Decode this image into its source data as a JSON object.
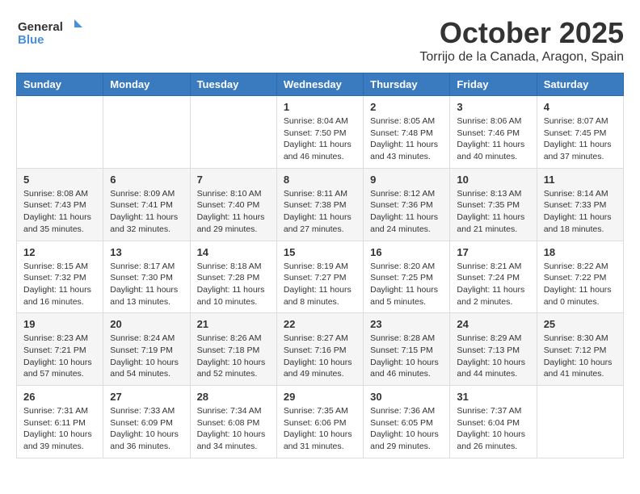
{
  "header": {
    "logo_general": "General",
    "logo_blue": "Blue",
    "month_title": "October 2025",
    "location": "Torrijo de la Canada, Aragon, Spain"
  },
  "days_of_week": [
    "Sunday",
    "Monday",
    "Tuesday",
    "Wednesday",
    "Thursday",
    "Friday",
    "Saturday"
  ],
  "weeks": [
    [
      {
        "day": "",
        "info": ""
      },
      {
        "day": "",
        "info": ""
      },
      {
        "day": "",
        "info": ""
      },
      {
        "day": "1",
        "info": "Sunrise: 8:04 AM\nSunset: 7:50 PM\nDaylight: 11 hours\nand 46 minutes."
      },
      {
        "day": "2",
        "info": "Sunrise: 8:05 AM\nSunset: 7:48 PM\nDaylight: 11 hours\nand 43 minutes."
      },
      {
        "day": "3",
        "info": "Sunrise: 8:06 AM\nSunset: 7:46 PM\nDaylight: 11 hours\nand 40 minutes."
      },
      {
        "day": "4",
        "info": "Sunrise: 8:07 AM\nSunset: 7:45 PM\nDaylight: 11 hours\nand 37 minutes."
      }
    ],
    [
      {
        "day": "5",
        "info": "Sunrise: 8:08 AM\nSunset: 7:43 PM\nDaylight: 11 hours\nand 35 minutes."
      },
      {
        "day": "6",
        "info": "Sunrise: 8:09 AM\nSunset: 7:41 PM\nDaylight: 11 hours\nand 32 minutes."
      },
      {
        "day": "7",
        "info": "Sunrise: 8:10 AM\nSunset: 7:40 PM\nDaylight: 11 hours\nand 29 minutes."
      },
      {
        "day": "8",
        "info": "Sunrise: 8:11 AM\nSunset: 7:38 PM\nDaylight: 11 hours\nand 27 minutes."
      },
      {
        "day": "9",
        "info": "Sunrise: 8:12 AM\nSunset: 7:36 PM\nDaylight: 11 hours\nand 24 minutes."
      },
      {
        "day": "10",
        "info": "Sunrise: 8:13 AM\nSunset: 7:35 PM\nDaylight: 11 hours\nand 21 minutes."
      },
      {
        "day": "11",
        "info": "Sunrise: 8:14 AM\nSunset: 7:33 PM\nDaylight: 11 hours\nand 18 minutes."
      }
    ],
    [
      {
        "day": "12",
        "info": "Sunrise: 8:15 AM\nSunset: 7:32 PM\nDaylight: 11 hours\nand 16 minutes."
      },
      {
        "day": "13",
        "info": "Sunrise: 8:17 AM\nSunset: 7:30 PM\nDaylight: 11 hours\nand 13 minutes."
      },
      {
        "day": "14",
        "info": "Sunrise: 8:18 AM\nSunset: 7:28 PM\nDaylight: 11 hours\nand 10 minutes."
      },
      {
        "day": "15",
        "info": "Sunrise: 8:19 AM\nSunset: 7:27 PM\nDaylight: 11 hours\nand 8 minutes."
      },
      {
        "day": "16",
        "info": "Sunrise: 8:20 AM\nSunset: 7:25 PM\nDaylight: 11 hours\nand 5 minutes."
      },
      {
        "day": "17",
        "info": "Sunrise: 8:21 AM\nSunset: 7:24 PM\nDaylight: 11 hours\nand 2 minutes."
      },
      {
        "day": "18",
        "info": "Sunrise: 8:22 AM\nSunset: 7:22 PM\nDaylight: 11 hours\nand 0 minutes."
      }
    ],
    [
      {
        "day": "19",
        "info": "Sunrise: 8:23 AM\nSunset: 7:21 PM\nDaylight: 10 hours\nand 57 minutes."
      },
      {
        "day": "20",
        "info": "Sunrise: 8:24 AM\nSunset: 7:19 PM\nDaylight: 10 hours\nand 54 minutes."
      },
      {
        "day": "21",
        "info": "Sunrise: 8:26 AM\nSunset: 7:18 PM\nDaylight: 10 hours\nand 52 minutes."
      },
      {
        "day": "22",
        "info": "Sunrise: 8:27 AM\nSunset: 7:16 PM\nDaylight: 10 hours\nand 49 minutes."
      },
      {
        "day": "23",
        "info": "Sunrise: 8:28 AM\nSunset: 7:15 PM\nDaylight: 10 hours\nand 46 minutes."
      },
      {
        "day": "24",
        "info": "Sunrise: 8:29 AM\nSunset: 7:13 PM\nDaylight: 10 hours\nand 44 minutes."
      },
      {
        "day": "25",
        "info": "Sunrise: 8:30 AM\nSunset: 7:12 PM\nDaylight: 10 hours\nand 41 minutes."
      }
    ],
    [
      {
        "day": "26",
        "info": "Sunrise: 7:31 AM\nSunset: 6:11 PM\nDaylight: 10 hours\nand 39 minutes."
      },
      {
        "day": "27",
        "info": "Sunrise: 7:33 AM\nSunset: 6:09 PM\nDaylight: 10 hours\nand 36 minutes."
      },
      {
        "day": "28",
        "info": "Sunrise: 7:34 AM\nSunset: 6:08 PM\nDaylight: 10 hours\nand 34 minutes."
      },
      {
        "day": "29",
        "info": "Sunrise: 7:35 AM\nSunset: 6:06 PM\nDaylight: 10 hours\nand 31 minutes."
      },
      {
        "day": "30",
        "info": "Sunrise: 7:36 AM\nSunset: 6:05 PM\nDaylight: 10 hours\nand 29 minutes."
      },
      {
        "day": "31",
        "info": "Sunrise: 7:37 AM\nSunset: 6:04 PM\nDaylight: 10 hours\nand 26 minutes."
      },
      {
        "day": "",
        "info": ""
      }
    ]
  ]
}
